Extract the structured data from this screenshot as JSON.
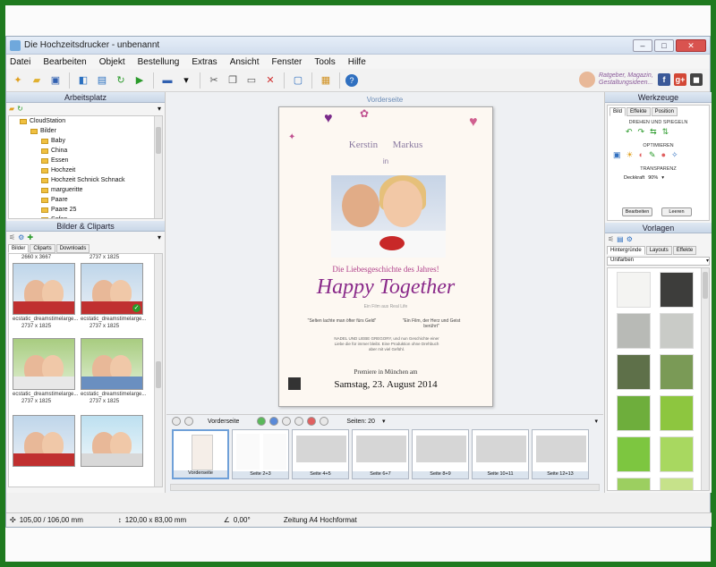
{
  "window": {
    "title": "Die Hochzeitsdrucker - unbenannt"
  },
  "menu": [
    "Datei",
    "Bearbeiten",
    "Objekt",
    "Bestellung",
    "Extras",
    "Ansicht",
    "Fenster",
    "Tools",
    "Hilfe"
  ],
  "promo": {
    "text": "Ratgeber, Magazin, Gestaltungsideen..."
  },
  "left": {
    "workspace_title": "Arbeitsplatz",
    "tree": [
      {
        "label": "CloudStation",
        "indent": 1
      },
      {
        "label": "Bilder",
        "indent": 2
      },
      {
        "label": "Baby",
        "indent": 3
      },
      {
        "label": "China",
        "indent": 3
      },
      {
        "label": "Essen",
        "indent": 3
      },
      {
        "label": "Hochzeit",
        "indent": 3
      },
      {
        "label": "Hochzeit Schnick Schnack",
        "indent": 3
      },
      {
        "label": "margueritte",
        "indent": 3
      },
      {
        "label": "Paare",
        "indent": 3
      },
      {
        "label": "Paare 25",
        "indent": 3
      },
      {
        "label": "Sofan",
        "indent": 3
      }
    ],
    "cliparts_title": "Bilder & Cliparts",
    "tabs": [
      "Bilder",
      "Cliparts",
      "Downloads"
    ],
    "thumbs": [
      {
        "top_label": "2660 x 3667",
        "caption": "ecstatic_dreamstimelarge...",
        "size": "2737 x 1825"
      },
      {
        "top_label": "2737 x 1825",
        "caption": "ecstatic_dreamstimelarge...",
        "size": "2737 x 1825"
      },
      {
        "top_label": "",
        "caption": "ecstatic_dreamstimelarge...",
        "size": "2737 x 1825"
      },
      {
        "top_label": "",
        "caption": "ecstatic_dreamstimelarge...",
        "size": "2737 x 1825"
      },
      {
        "top_label": "",
        "caption": "",
        "size": ""
      },
      {
        "top_label": "",
        "caption": "",
        "size": ""
      }
    ]
  },
  "center": {
    "page_label": "Vorderseite",
    "poster": {
      "names_left": "Kerstin",
      "names_right": "Markus",
      "in": "in",
      "subtitle": "Die Liebesgeschichte des Jahres!",
      "title": "Happy Together",
      "tagline": "Ein Film aus Real Life",
      "quote_left": "\"Selten lachte man öfter fürs Geld\"",
      "quote_right": "\"Ein Film, der Herz und Geist berührt\"",
      "credits": "NADEL UND LIEBE GREGORY, und nun Geschichte einer Liebe die für immer bleibt. Eine Produktion ohne Drehbuch aber mit viel Gefühl.",
      "premiere": "Premiere in München am",
      "date": "Samstag, 23. August 2014"
    },
    "filmstrip": {
      "label": "Vorderseite",
      "pages_label": "Seiten: 20",
      "thumbs": [
        "Vorderseite",
        "Seite 2+3",
        "Seite 4+5",
        "Seite 6+7",
        "Seite 8+9",
        "Seite 10+11",
        "Seite 12+13"
      ]
    }
  },
  "right": {
    "tools_title": "Werkzeuge",
    "tool_tabs": [
      "Bild",
      "Effekte",
      "Position"
    ],
    "rotate_label": "DREHEN UND SPIEGELN",
    "optimize_label": "OPTIMIEREN",
    "transparency_label": "TRANSPARENZ",
    "transparency_mode": "Deckkraft",
    "transparency_value": "90%",
    "edit_button": "Bearbeiten",
    "clear_button": "Leeren",
    "templates_title": "Vorlagen",
    "template_tabs": [
      "Hintergründe",
      "Layouts",
      "Effekte"
    ],
    "filter": "Unifarben",
    "swatches": [
      "#f4f4f2",
      "#3d3d3b",
      "#b8bab6",
      "#c9cbc7",
      "#5e7049",
      "#7a9a56",
      "#6eae3c",
      "#8dc63f",
      "#7dc640",
      "#a8d860",
      "#9ccf60",
      "#c6e28a"
    ]
  },
  "status": {
    "position": "105,00 / 106,00 mm",
    "size": "120,00 x 83,00 mm",
    "angle": "0,00°",
    "format": "Zeitung A4 Hochformat"
  }
}
